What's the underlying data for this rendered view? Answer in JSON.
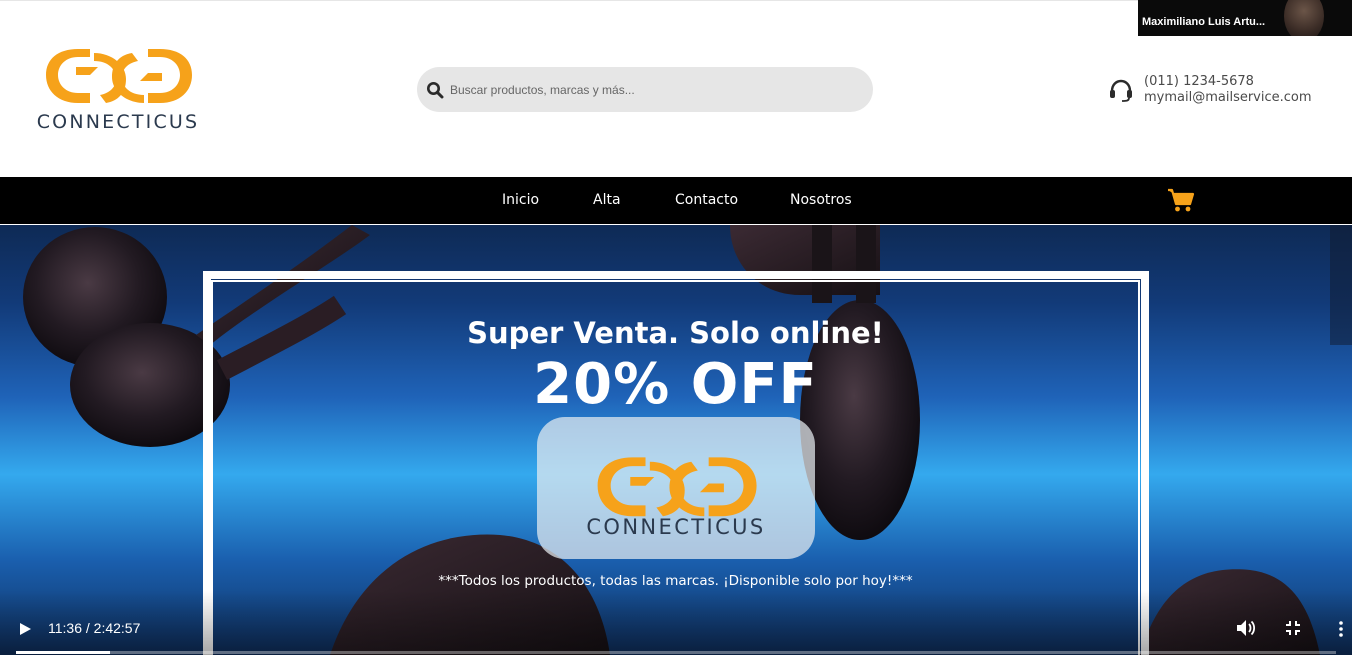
{
  "brand": {
    "name": "CONNECTICUS",
    "colors": {
      "orange": "#f6a21a",
      "navy": "#2b3a4e",
      "nav_bg": "#000000",
      "cart": "#f6a21a"
    }
  },
  "search": {
    "placeholder": "Buscar productos, marcas y más..."
  },
  "contact": {
    "phone": "(011) 1234-5678",
    "email": "mymail@mailservice.com",
    "icon": "headset-icon"
  },
  "webcam": {
    "name": "Maximiliano Luis Artu..."
  },
  "nav": {
    "items": [
      {
        "label": "Inicio"
      },
      {
        "label": "Alta"
      },
      {
        "label": "Contacto"
      },
      {
        "label": "Nosotros"
      }
    ],
    "cart_icon": "cart-icon"
  },
  "hero": {
    "headline": "Super Venta. Solo online!",
    "discount": "20% OFF",
    "card_brand": "CONNECTICUS",
    "tagline": "***Todos los productos, todas las marcas. ¡Disponible solo por hoy!***"
  },
  "video": {
    "time": "11:36 / 2:42:57",
    "progress": 0.0712,
    "icons": [
      "play-icon",
      "volume-icon",
      "exit-fullscreen-icon",
      "more-options-icon"
    ]
  }
}
